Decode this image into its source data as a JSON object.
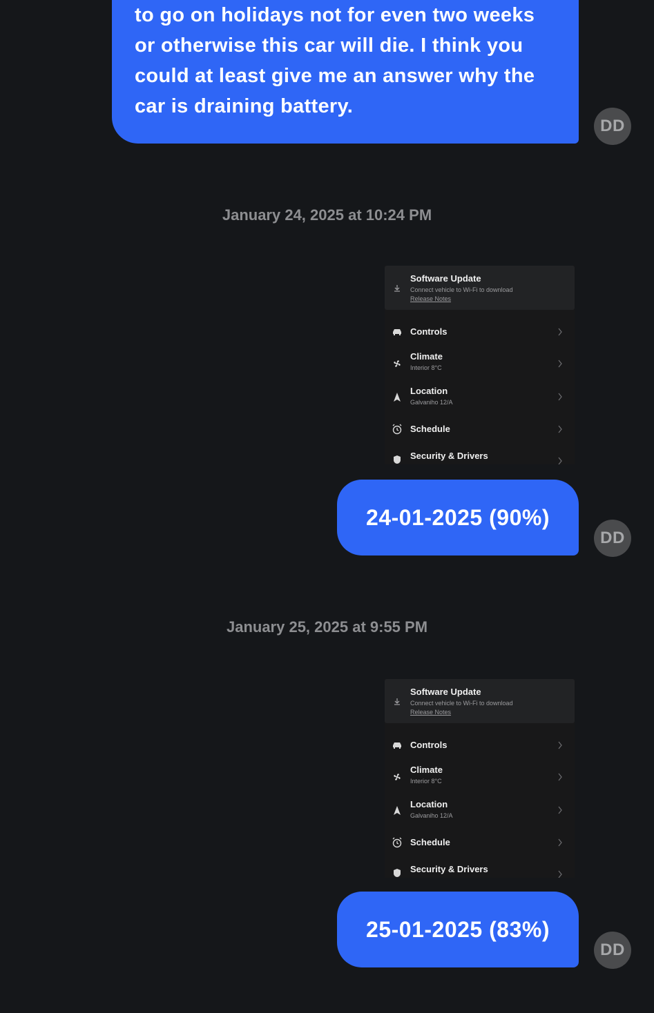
{
  "messages": [
    {
      "text": "to go on holidays not for even two weeks or otherwise this car will die. I think you could at least give me an answer why the car is draining battery.",
      "avatar": "DD"
    },
    {
      "timestamp": "January 24, 2025 at 10:24 PM"
    },
    {
      "text": "24-01-2025 (90%)",
      "avatar": "DD"
    },
    {
      "timestamp": "January 25, 2025 at 9:55 PM"
    },
    {
      "text": "25-01-2025 (83%)",
      "avatar": "DD"
    }
  ],
  "screenshot_card": {
    "update_title": "Software Update",
    "update_subtitle": "Connect vehicle to Wi-Fi to download",
    "update_link": "Release Notes",
    "items": [
      {
        "label": "Controls",
        "sub": "",
        "icon": "car-icon"
      },
      {
        "label": "Climate",
        "sub": "Interior 8°C",
        "icon": "fan-icon"
      },
      {
        "label": "Location",
        "sub": "Galvaniho 12/A",
        "icon": "navigation-arrow-icon"
      },
      {
        "label": "Schedule",
        "sub": "",
        "icon": "alarm-clock-icon"
      },
      {
        "label": "Security & Drivers",
        "sub": "",
        "icon": "shield-icon"
      }
    ]
  },
  "colors": {
    "bubble": "#2f66f6",
    "background": "#15171a",
    "avatar": "#4a4b4d"
  }
}
